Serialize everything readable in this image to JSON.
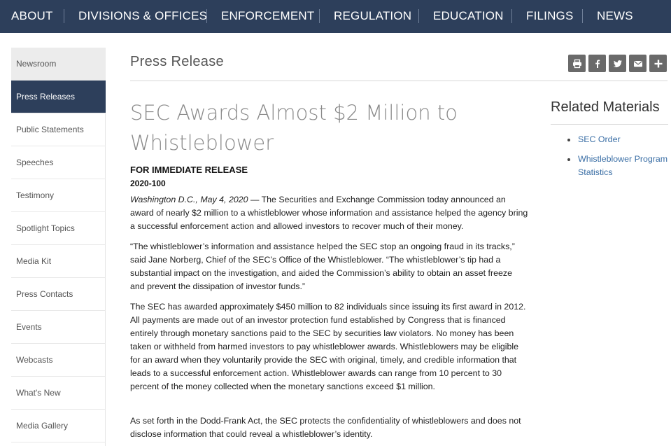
{
  "topnav": {
    "items": [
      "ABOUT",
      "DIVISIONS & OFFICES",
      "ENFORCEMENT",
      "REGULATION",
      "EDUCATION",
      "FILINGS",
      "NEWS"
    ]
  },
  "sidebar": {
    "items": [
      {
        "label": "Newsroom"
      },
      {
        "label": "Press Releases",
        "active": true
      },
      {
        "label": "Public Statements"
      },
      {
        "label": "Speeches"
      },
      {
        "label": "Testimony"
      },
      {
        "label": "Spotlight Topics"
      },
      {
        "label": "Media Kit"
      },
      {
        "label": "Press Contacts"
      },
      {
        "label": "Events"
      },
      {
        "label": "Webcasts"
      },
      {
        "label": "What's New"
      },
      {
        "label": "Media Gallery"
      }
    ]
  },
  "header": {
    "title": "Press Release"
  },
  "share_icons": [
    "print-icon",
    "facebook-icon",
    "twitter-icon",
    "email-icon",
    "plus-icon"
  ],
  "article": {
    "headline": "SEC Awards Almost $2 Million to Whistleblower",
    "release_label": "FOR IMMEDIATE RELEASE",
    "release_number": "2020-100",
    "dateline": "Washington D.C., May 4, 2020",
    "p1": " — The Securities and Exchange Commission today announced an award of nearly $2 million to a whistleblower whose information and assistance helped the agency bring a successful enforcement action and allowed investors to recover much of their money.",
    "p2": "“The whistleblower’s information and assistance helped the SEC stop an ongoing fraud in its tracks,” said Jane Norberg, Chief of the SEC’s Office of the Whistleblower.  “The whistleblower’s tip had a substantial impact on the investigation, and aided the Commission’s ability to obtain an asset freeze and prevent the dissipation of investor funds.”",
    "p3": "The SEC has awarded approximately $450 million to 82 individuals since issuing its first award in 2012.  All payments are made out of an investor protection fund established by Congress that is financed entirely through monetary sanctions paid to the SEC by securities law violators.  No money has been taken or withheld from harmed investors to pay whistleblower awards.  Whistleblowers may be eligible for an award when they voluntarily provide the SEC with original, timely, and credible information that leads to a successful enforcement action.  Whistleblower awards can range from 10 percent to 30 percent of the money collected when the monetary sanctions exceed $1 million.",
    "p4": "As set forth in the Dodd-Frank Act, the SEC protects the confidentiality of whistleblowers and does not disclose information that could reveal a whistleblower’s identity."
  },
  "related": {
    "title": "Related Materials",
    "items": [
      "SEC Order",
      "Whistleblower Program Statistics"
    ]
  },
  "colors": {
    "nav_bg": "#2d3f5b",
    "link": "#3a6ea5",
    "share_bg": "#6a6a6a"
  }
}
